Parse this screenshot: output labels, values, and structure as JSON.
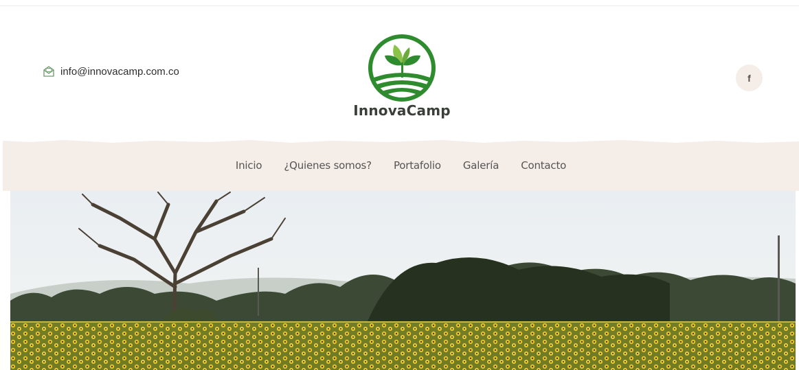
{
  "header": {
    "email": "info@innovacamp.com.co",
    "email_icon": "envelope-icon",
    "brand": "InnovaCamp",
    "facebook_icon_glyph": "f",
    "brand_color": "#2e8b2e"
  },
  "nav": {
    "items": [
      {
        "label": "Inicio"
      },
      {
        "label": "¿Quienes somos?"
      },
      {
        "label": "Portafolio"
      },
      {
        "label": "Galería"
      },
      {
        "label": "Contacto"
      }
    ]
  },
  "colors": {
    "nav_band": "#f5ede8",
    "text": "#2d2d2d"
  }
}
